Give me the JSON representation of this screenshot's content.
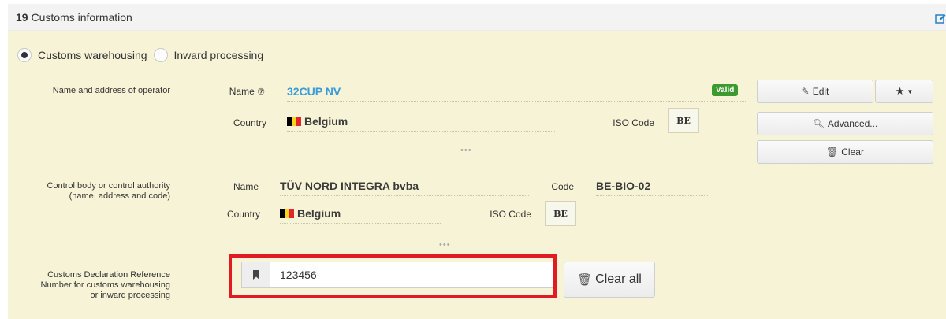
{
  "header": {
    "section_number": "19",
    "section_title": "Customs information"
  },
  "regime": {
    "options": [
      {
        "label": "Customs warehousing",
        "checked": true
      },
      {
        "label": "Inward processing",
        "checked": false
      }
    ]
  },
  "operator": {
    "row_label": "Name and address of operator",
    "name_label": "Name",
    "name_value": "32CUP NV",
    "status_badge": "Valid",
    "country_label": "Country",
    "country_value": "Belgium",
    "iso_label": "ISO Code",
    "iso_value": "BE",
    "more": "•••"
  },
  "operator_buttons": {
    "edit": "Edit",
    "advanced": "Advanced...",
    "clear": "Clear"
  },
  "control_body": {
    "row_label_line1": "Control body or control authority",
    "row_label_line2": "(name, address and code)",
    "name_label": "Name",
    "name_value": "TÜV NORD INTEGRA bvba",
    "code_label": "Code",
    "code_value": "BE-BIO-02",
    "country_label": "Country",
    "country_value": "Belgium",
    "iso_label": "ISO Code",
    "iso_value": "BE",
    "more": "•••"
  },
  "cdr": {
    "row_label_line1": "Customs Declaration Reference",
    "row_label_line2": "Number for customs warehousing",
    "row_label_line3": "or inward processing",
    "value": "123456",
    "clear_all": "Clear all"
  },
  "colors": {
    "panel_body": "#f6f3d6",
    "link": "#3a9bd9",
    "badge": "#3d9a2e",
    "highlight": "#e11b22"
  }
}
